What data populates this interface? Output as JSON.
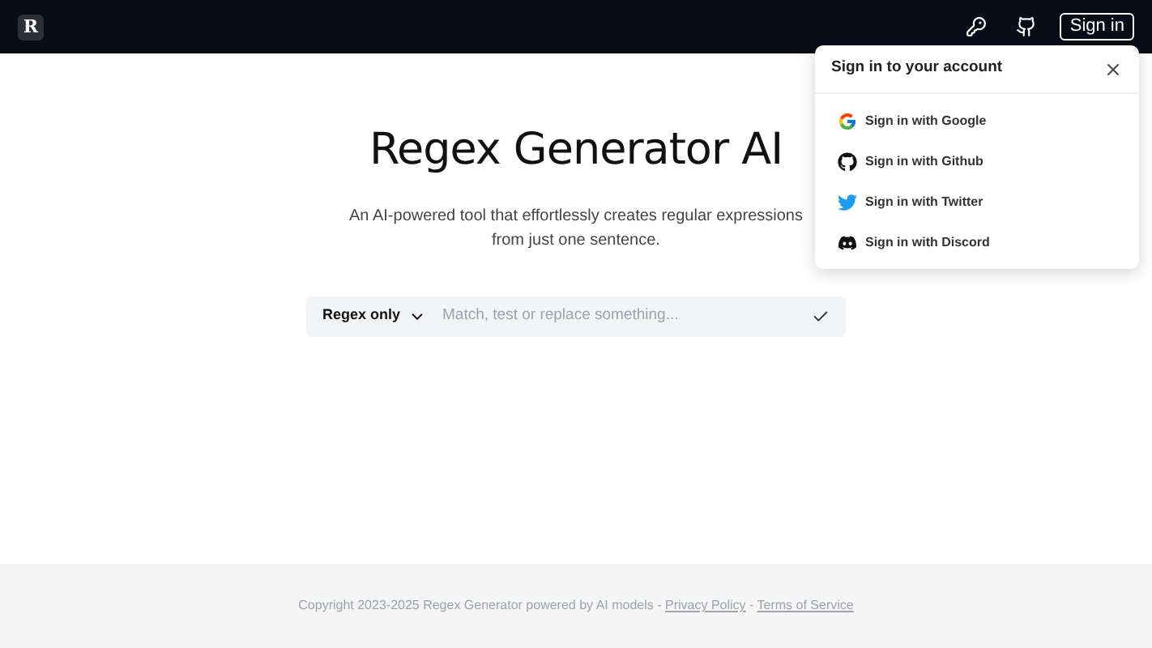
{
  "header": {
    "logo": "R",
    "sign_in": "Sign in"
  },
  "hero": {
    "title": "Regex Generator AI",
    "subtitle": "An AI-powered tool that effortlessly creates regular expressions from just one sentence."
  },
  "search": {
    "mode": "Regex only",
    "placeholder": "Match, test or replace something..."
  },
  "sign_in_popup": {
    "title": "Sign in to your account",
    "providers": [
      {
        "kind": "google",
        "label": "Sign in with Google"
      },
      {
        "kind": "github",
        "label": "Sign in with Github"
      },
      {
        "kind": "twitter",
        "label": "Sign in with Twitter"
      },
      {
        "kind": "discord",
        "label": "Sign in with Discord"
      }
    ]
  },
  "footer": {
    "text": "Copyright 2023-2025 Regex Generator powered by AI models - ",
    "separator": " - ",
    "links": [
      "Privacy Policy",
      "Terms of Service"
    ]
  }
}
